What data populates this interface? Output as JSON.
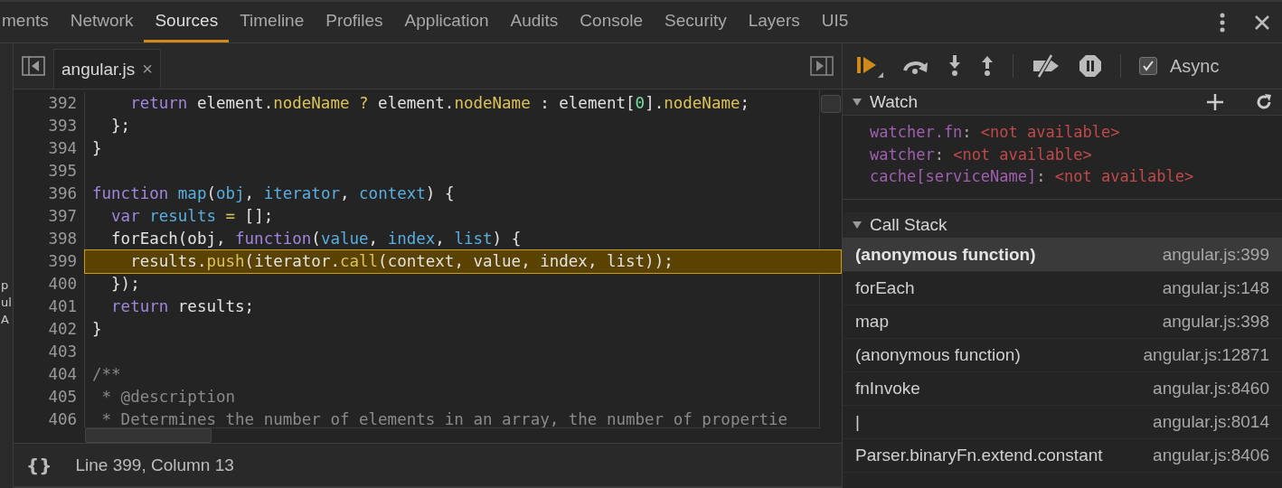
{
  "panel_tabs": [
    {
      "label": "ments",
      "selected": false
    },
    {
      "label": "Network",
      "selected": false
    },
    {
      "label": "Sources",
      "selected": true
    },
    {
      "label": "Timeline",
      "selected": false
    },
    {
      "label": "Profiles",
      "selected": false
    },
    {
      "label": "Application",
      "selected": false
    },
    {
      "label": "Audits",
      "selected": false
    },
    {
      "label": "Console",
      "selected": false
    },
    {
      "label": "Security",
      "selected": false
    },
    {
      "label": "Layers",
      "selected": false
    },
    {
      "label": "UI5",
      "selected": false
    }
  ],
  "navigator_fragments": [
    "p",
    "ul",
    "A"
  ],
  "editor": {
    "file_tab": {
      "label": "angular.js",
      "close": "×"
    },
    "lines": [
      {
        "number": "392",
        "current": false,
        "tokens": [
          {
            "text": "    return",
            "kind": "keyword"
          },
          {
            "text": " element.",
            "kind": "plain"
          },
          {
            "text": "nodeName",
            "kind": "prop"
          },
          {
            "text": " ? ",
            "kind": "op"
          },
          {
            "text": "element.",
            "kind": "plain"
          },
          {
            "text": "nodeName",
            "kind": "prop"
          },
          {
            "text": " : element[",
            "kind": "plain"
          },
          {
            "text": "0",
            "kind": "number"
          },
          {
            "text": "].",
            "kind": "plain"
          },
          {
            "text": "nodeName",
            "kind": "prop"
          },
          {
            "text": ";",
            "kind": "plain"
          }
        ]
      },
      {
        "number": "393",
        "current": false,
        "tokens": [
          {
            "text": "  };",
            "kind": "plain"
          }
        ]
      },
      {
        "number": "394",
        "current": false,
        "tokens": [
          {
            "text": "}",
            "kind": "plain"
          }
        ]
      },
      {
        "number": "395",
        "current": false
      },
      {
        "number": "396",
        "current": false,
        "tokens": [
          {
            "text": "function",
            "kind": "keyword"
          },
          {
            "text": " map",
            "kind": "var"
          },
          {
            "text": "(",
            "kind": "plain"
          },
          {
            "text": "obj",
            "kind": "var"
          },
          {
            "text": ", ",
            "kind": "plain"
          },
          {
            "text": "iterator",
            "kind": "var"
          },
          {
            "text": ", ",
            "kind": "plain"
          },
          {
            "text": "context",
            "kind": "var"
          },
          {
            "text": ") {",
            "kind": "plain"
          }
        ]
      },
      {
        "number": "397",
        "current": false,
        "tokens": [
          {
            "text": "  var",
            "kind": "keyword"
          },
          {
            "text": " results",
            "kind": "var"
          },
          {
            "text": " = ",
            "kind": "op"
          },
          {
            "text": "[];",
            "kind": "plain"
          }
        ]
      },
      {
        "number": "398",
        "current": false,
        "tokens": [
          {
            "text": "  forEach(obj, ",
            "kind": "plain"
          },
          {
            "text": "function",
            "kind": "keyword"
          },
          {
            "text": "(",
            "kind": "plain"
          },
          {
            "text": "value",
            "kind": "var"
          },
          {
            "text": ", ",
            "kind": "plain"
          },
          {
            "text": "index",
            "kind": "var"
          },
          {
            "text": ", ",
            "kind": "plain"
          },
          {
            "text": "list",
            "kind": "var"
          },
          {
            "text": ") {",
            "kind": "plain"
          }
        ]
      },
      {
        "number": "399",
        "current": true,
        "tokens": [
          {
            "text": "    results.",
            "kind": "plain"
          },
          {
            "text": "push",
            "kind": "prop"
          },
          {
            "text": "(iterator.",
            "kind": "plain"
          },
          {
            "text": "call",
            "kind": "prop"
          },
          {
            "text": "(context, value, index, list));",
            "kind": "plain"
          }
        ]
      },
      {
        "number": "400",
        "current": false,
        "tokens": [
          {
            "text": "  });",
            "kind": "plain"
          }
        ]
      },
      {
        "number": "401",
        "current": false,
        "tokens": [
          {
            "text": "  return",
            "kind": "keyword"
          },
          {
            "text": " results;",
            "kind": "plain"
          }
        ]
      },
      {
        "number": "402",
        "current": false,
        "tokens": [
          {
            "text": "}",
            "kind": "plain"
          }
        ]
      },
      {
        "number": "403",
        "current": false
      },
      {
        "number": "404",
        "current": false,
        "tokens": [
          {
            "text": "/**",
            "kind": "comment"
          }
        ]
      },
      {
        "number": "405",
        "current": false,
        "tokens": [
          {
            "text": " * @description",
            "kind": "comment"
          }
        ]
      },
      {
        "number": "406",
        "current": false,
        "tokens": [
          {
            "text": " * Determines the number of elements in an array, the number of propertie",
            "kind": "comment"
          }
        ]
      }
    ],
    "status": {
      "format_button": "{}",
      "position": "Line 399, Column 13"
    }
  },
  "debugger": {
    "async": {
      "label": "Async",
      "checked": true
    },
    "watch": {
      "title": "Watch",
      "expanded": true,
      "items": [
        {
          "name": "watcher.fn",
          "separator": ":",
          "value": "<not available>"
        },
        {
          "name": "watcher",
          "separator": ":",
          "value": "<not available>"
        },
        {
          "name": "cache[serviceName]",
          "separator": ":",
          "value": "<not available>"
        }
      ]
    },
    "call_stack": {
      "title": "Call Stack",
      "expanded": true,
      "frames": [
        {
          "name": "(anonymous function)",
          "location": "angular.js:399",
          "selected": true
        },
        {
          "name": "forEach",
          "location": "angular.js:148",
          "selected": false
        },
        {
          "name": "map",
          "location": "angular.js:398",
          "selected": false
        },
        {
          "name": "(anonymous function)",
          "location": "angular.js:12871",
          "selected": false
        },
        {
          "name": "fnInvoke",
          "location": "angular.js:8460",
          "selected": false
        },
        {
          "name": "|",
          "location": "angular.js:8014",
          "selected": false
        },
        {
          "name": "Parser.binaryFn.extend.constant",
          "location": "angular.js:8406",
          "selected": false
        }
      ]
    }
  }
}
